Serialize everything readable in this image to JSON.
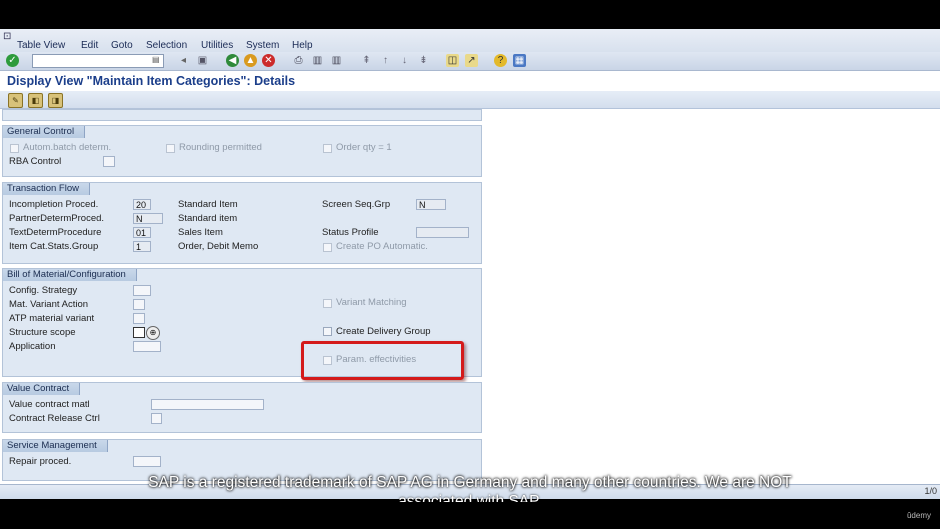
{
  "menu": {
    "items": [
      "Table View",
      "Edit",
      "Goto",
      "Selection",
      "Utilities",
      "System",
      "Help"
    ]
  },
  "screen_title": "Display View \"Maintain Item Categories\": Details",
  "general_control": {
    "title": "General Control",
    "autom_batch": "Autom.batch determ.",
    "rounding": "Rounding permitted",
    "order_qty": "Order qty = 1",
    "rba": "RBA Control"
  },
  "transaction_flow": {
    "title": "Transaction Flow",
    "rows": [
      {
        "label": "Incompletion Proced.",
        "value": "20",
        "desc": "Standard Item"
      },
      {
        "label": "PartnerDetermProced.",
        "value": "N",
        "desc": "Standard item"
      },
      {
        "label": "TextDetermProcedure",
        "value": "01",
        "desc": "Sales Item"
      },
      {
        "label": "Item Cat.Stats.Group",
        "value": "1",
        "desc": "Order, Debit Memo"
      }
    ],
    "screen_seq_label": "Screen Seq.Grp",
    "screen_seq_value": "N",
    "status_profile": "Status Profile",
    "create_po": "Create PO Automatic."
  },
  "bom": {
    "title": "Bill of Material/Configuration",
    "config": "Config. Strategy",
    "mat_variant": "Mat. Variant Action",
    "atp": "ATP material variant",
    "structure": "Structure scope",
    "application": "Application",
    "variant_matching": "Variant Matching",
    "create_delivery_group": "Create Delivery Group",
    "param_eff": "Param. effectivities"
  },
  "value_contract": {
    "title": "Value Contract",
    "matl": "Value contract matl",
    "release": "Contract Release Ctrl"
  },
  "service_mgmt": {
    "title": "Service Management",
    "repair": "Repair proced."
  },
  "status_bar": {
    "page": "1/0"
  },
  "caption": {
    "line1": "SAP is a registered trademark of SAP AG in Germany and many other countries. We are NOT",
    "line2": "associated with SAP."
  },
  "watermark": "ûdemy"
}
